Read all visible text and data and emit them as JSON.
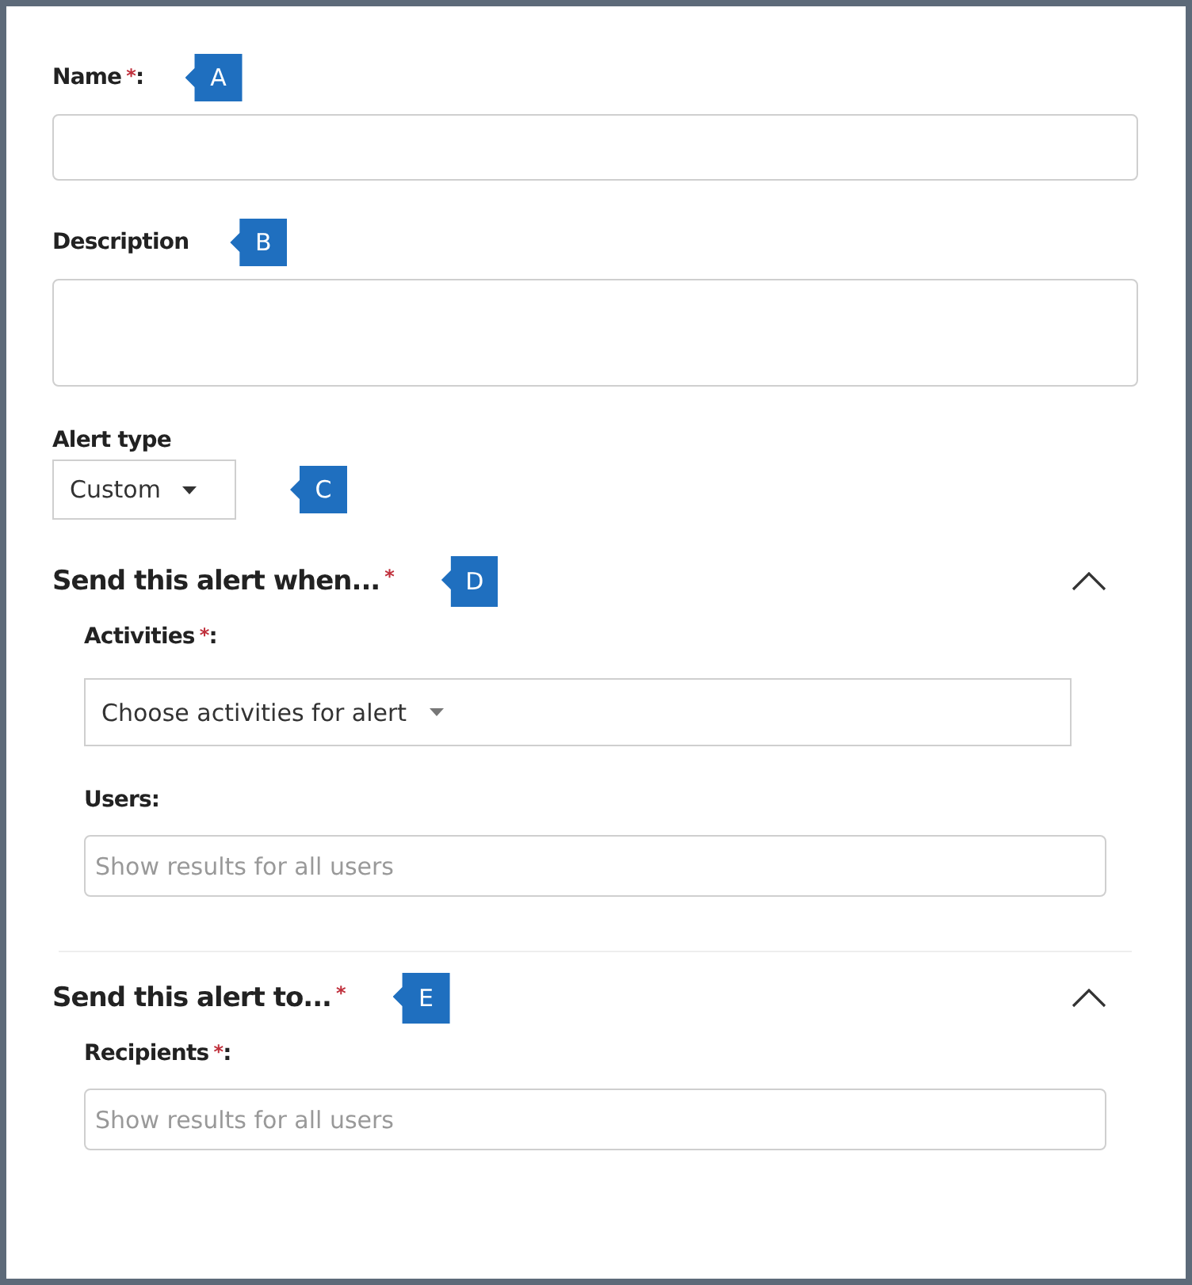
{
  "fields": [
    {
      "kind": "text",
      "label": "Name",
      "asterisk": "*",
      "colon": ":",
      "callout": "A"
    },
    {
      "kind": "textarea",
      "label": "Description",
      "callout": "B"
    },
    {
      "kind": "select",
      "label": "Alert type",
      "value": "Custom",
      "callout": "C"
    }
  ],
  "sections": [
    {
      "title": "Send this alert when...",
      "asterisk": "*",
      "callout": "D",
      "expanded": true,
      "fields": [
        {
          "kind": "wide-select",
          "label": "Activities",
          "asterisk": "*",
          "colon": ":",
          "placeholder": "Choose activities for alert"
        },
        {
          "kind": "search",
          "label": "Users:",
          "placeholder": "Show results for all users"
        }
      ]
    },
    {
      "title": "Send this alert to...",
      "asterisk": "*",
      "callout": "E",
      "expanded": true,
      "fields": [
        {
          "kind": "search",
          "label": "Recipients",
          "asterisk": "*",
          "colon": ":",
          "placeholder": "Show results for all users"
        }
      ]
    }
  ]
}
